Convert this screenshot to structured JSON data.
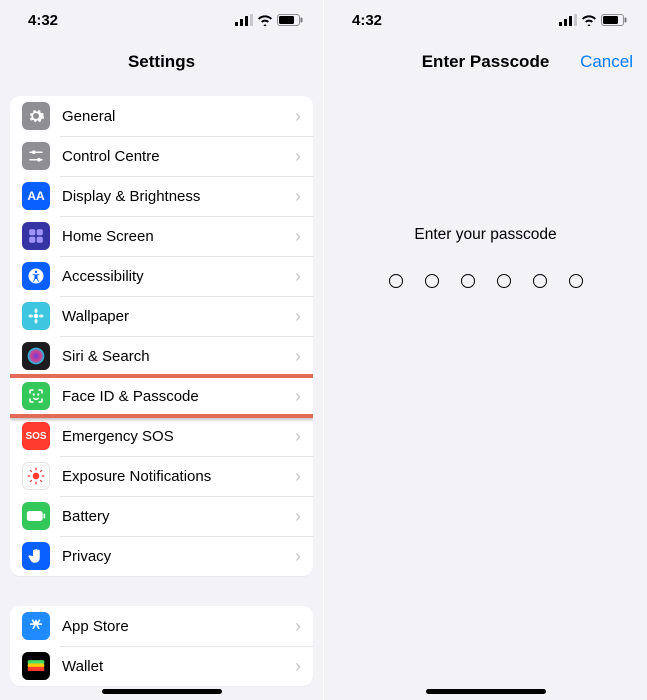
{
  "status": {
    "time": "4:32"
  },
  "settings": {
    "title": "Settings",
    "group1": [
      {
        "label": "General",
        "bg": "#8e8e93",
        "glyph": "gear"
      },
      {
        "label": "Control Centre",
        "bg": "#8e8e93",
        "glyph": "sliders"
      },
      {
        "label": "Display & Brightness",
        "bg": "#0a60ff",
        "glyph": "AA"
      },
      {
        "label": "Home Screen",
        "bg": "#3634a3",
        "glyph": "grid"
      },
      {
        "label": "Accessibility",
        "bg": "#0a60ff",
        "glyph": "accessibility"
      },
      {
        "label": "Wallpaper",
        "bg": "#3ec6e0",
        "glyph": "flower"
      },
      {
        "label": "Siri & Search",
        "bg": "#1c1c1e",
        "glyph": "siri"
      },
      {
        "label": "Face ID & Passcode",
        "bg": "#34c759",
        "glyph": "face",
        "highlight": true
      },
      {
        "label": "Emergency SOS",
        "bg": "#ff3b30",
        "glyph": "SOS"
      },
      {
        "label": "Exposure Notifications",
        "bg": "#ffffff",
        "glyph": "exposure"
      },
      {
        "label": "Battery",
        "bg": "#34c759",
        "glyph": "battery"
      },
      {
        "label": "Privacy",
        "bg": "#0a60ff",
        "glyph": "hand"
      }
    ],
    "group2": [
      {
        "label": "App Store",
        "bg": "#1f8bff",
        "glyph": "appstore"
      },
      {
        "label": "Wallet",
        "bg": "#000000",
        "glyph": "wallet"
      }
    ]
  },
  "passcode": {
    "title": "Enter Passcode",
    "cancel": "Cancel",
    "prompt": "Enter your passcode",
    "digits": 6
  }
}
